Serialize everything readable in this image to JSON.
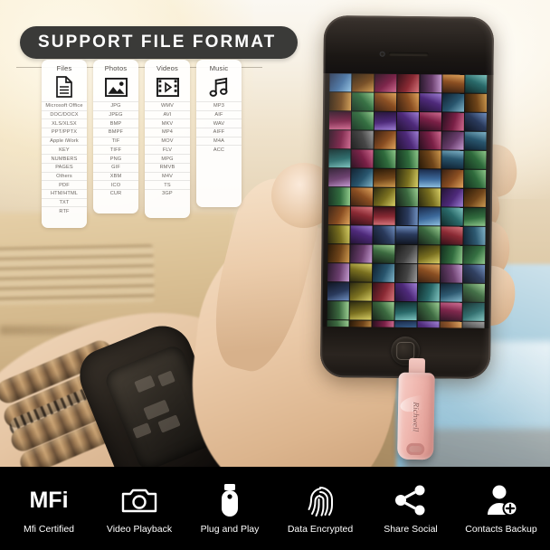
{
  "banner": {
    "title": "SUPPORT FILE FORMAT"
  },
  "cards": [
    {
      "title": "Files",
      "icon": "document-icon",
      "formats": [
        "Microsoft Office",
        "DOC/DOCX",
        "XLS/XLSX",
        "PPT/PPTX",
        "Apple iWork",
        "KEY",
        "NUMBERS",
        "PAGES",
        "Others",
        "PDF",
        "HTM/HTML",
        "TXT",
        "RTF"
      ]
    },
    {
      "title": "Photos",
      "icon": "image-icon",
      "formats": [
        "JPG",
        "JPEG",
        "BMP",
        "BMPF",
        "TIF",
        "TIFF",
        "PNG",
        "GIF",
        "XBM",
        "ICO",
        "CUR"
      ]
    },
    {
      "title": "Videos",
      "icon": "film-icon",
      "formats": [
        "WMV",
        "AVI",
        "MKV",
        "MP4",
        "MOV",
        "FLV",
        "MPG",
        "RMVB",
        "M4V",
        "TS",
        "3GP"
      ]
    },
    {
      "title": "Music",
      "icon": "music-note-icon",
      "formats": [
        "MP3",
        "AIF",
        "WAV",
        "AIFF",
        "M4A",
        "ACC"
      ]
    }
  ],
  "device": {
    "usb_brand": "Richwell",
    "usb_color": "#f0b9b1",
    "phone_color": "#151210"
  },
  "features": [
    {
      "label": "Mfi Certified",
      "icon": "mfi-text",
      "text": "MFi"
    },
    {
      "label": "Video Playback",
      "icon": "camera-icon"
    },
    {
      "label": "Plug and Play",
      "icon": "usb-drive-icon"
    },
    {
      "label": "Data Encrypted",
      "icon": "fingerprint-icon"
    },
    {
      "label": "Share Social",
      "icon": "share-icon"
    },
    {
      "label": "Contacts Backup",
      "icon": "user-add-icon"
    }
  ],
  "colors": {
    "banner_bg": "#3a3a38",
    "bar_bg": "#000000",
    "card_bg": "#ffffff",
    "text_light": "#ffffff"
  }
}
